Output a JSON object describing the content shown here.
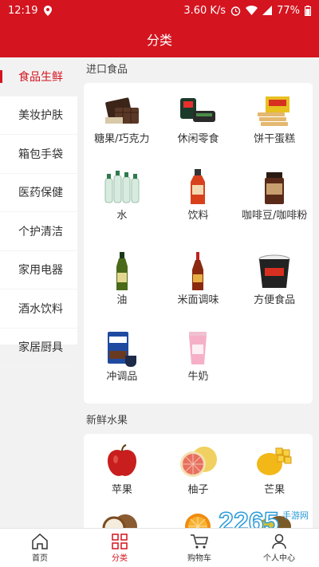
{
  "status": {
    "time": "12:19",
    "speed": "3.60 K/s",
    "battery": "77%"
  },
  "header": {
    "title": "分类"
  },
  "sidebar": {
    "items": [
      {
        "label": "食品生鲜",
        "active": true
      },
      {
        "label": "美妆护肤"
      },
      {
        "label": "箱包手袋"
      },
      {
        "label": "医药保健"
      },
      {
        "label": "个护清洁"
      },
      {
        "label": "家用电器"
      },
      {
        "label": "酒水饮料"
      },
      {
        "label": "家居厨具"
      }
    ]
  },
  "sections": [
    {
      "title": "进口食品",
      "items": [
        {
          "label": "糖果/巧克力",
          "icon": "chocolate-icon"
        },
        {
          "label": "休闲零食",
          "icon": "snack-icon"
        },
        {
          "label": "饼干蛋糕",
          "icon": "wafer-icon"
        },
        {
          "label": "水",
          "icon": "water-bottles-icon"
        },
        {
          "label": "饮料",
          "icon": "drink-bottle-icon"
        },
        {
          "label": "咖啡豆/咖啡粉",
          "icon": "coffee-jar-icon"
        },
        {
          "label": "油",
          "icon": "oil-bottle-icon"
        },
        {
          "label": "米面调味",
          "icon": "sauce-bottle-icon"
        },
        {
          "label": "方便食品",
          "icon": "instant-noodle-icon"
        },
        {
          "label": "冲调品",
          "icon": "drink-mix-icon"
        },
        {
          "label": "牛奶",
          "icon": "milk-cup-icon"
        }
      ]
    },
    {
      "title": "新鲜水果",
      "items": [
        {
          "label": "苹果",
          "icon": "apple-icon"
        },
        {
          "label": "柚子",
          "icon": "pomelo-icon"
        },
        {
          "label": "芒果",
          "icon": "mango-icon"
        },
        {
          "label": "",
          "icon": "coconut-icon"
        },
        {
          "label": "",
          "icon": "orange-icon"
        },
        {
          "label": "",
          "icon": "kiwi-icon"
        }
      ]
    }
  ],
  "nav": {
    "items": [
      {
        "label": "首页",
        "icon": "home-icon"
      },
      {
        "label": "分类",
        "icon": "category-grid-icon",
        "active": true
      },
      {
        "label": "购物车",
        "icon": "cart-icon"
      },
      {
        "label": "个人中心",
        "icon": "person-icon"
      }
    ]
  },
  "watermark": {
    "text": "2265",
    "sub": "手游网"
  },
  "colors": {
    "brand": "#d4141f",
    "background": "#f2f2f2"
  }
}
